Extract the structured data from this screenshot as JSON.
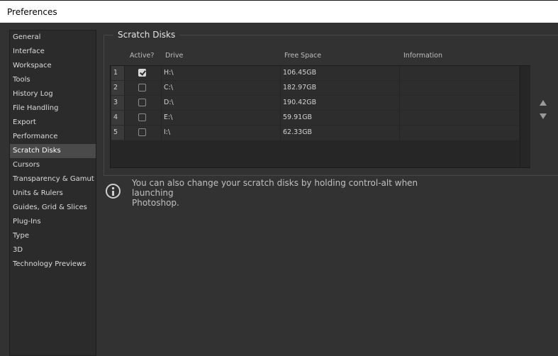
{
  "window": {
    "title": "Preferences"
  },
  "sidebar": {
    "items": [
      {
        "label": "General"
      },
      {
        "label": "Interface"
      },
      {
        "label": "Workspace"
      },
      {
        "label": "Tools"
      },
      {
        "label": "History Log"
      },
      {
        "label": "File Handling"
      },
      {
        "label": "Export"
      },
      {
        "label": "Performance"
      },
      {
        "label": "Scratch Disks",
        "selected": true
      },
      {
        "label": "Cursors"
      },
      {
        "label": "Transparency & Gamut"
      },
      {
        "label": "Units & Rulers"
      },
      {
        "label": "Guides, Grid & Slices"
      },
      {
        "label": "Plug-Ins"
      },
      {
        "label": "Type"
      },
      {
        "label": "3D"
      },
      {
        "label": "Technology Previews"
      }
    ]
  },
  "scratch_disks": {
    "group_title": "Scratch Disks",
    "columns": {
      "active": "Active?",
      "drive": "Drive",
      "free_space": "Free Space",
      "information": "Information"
    },
    "rows": [
      {
        "num": "1",
        "active": true,
        "drive": "H:\\",
        "free_space": "106.45GB",
        "information": ""
      },
      {
        "num": "2",
        "active": false,
        "drive": "C:\\",
        "free_space": "182.97GB",
        "information": ""
      },
      {
        "num": "3",
        "active": false,
        "drive": "D:\\",
        "free_space": "190.42GB",
        "information": ""
      },
      {
        "num": "4",
        "active": false,
        "drive": "E:\\",
        "free_space": "59.91GB",
        "information": ""
      },
      {
        "num": "5",
        "active": false,
        "drive": "I:\\",
        "free_space": "62.33GB",
        "information": ""
      }
    ],
    "move_up_icon": "triangle-up",
    "move_down_icon": "triangle-down"
  },
  "info": {
    "icon": "info-circle",
    "line1": "You can also change your scratch disks by holding control-alt when launching",
    "line2": "Photoshop."
  }
}
